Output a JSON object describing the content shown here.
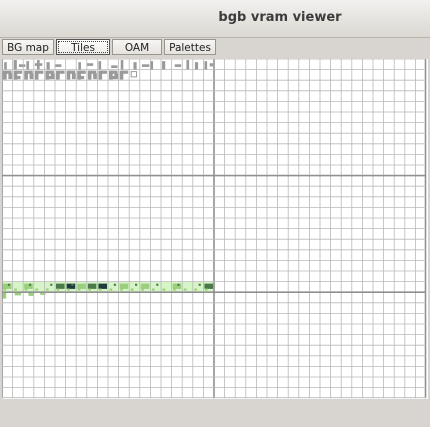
{
  "window": {
    "title": "bgb vram viewer"
  },
  "tabs": [
    {
      "label": "BG map",
      "active": false
    },
    {
      "label": "Tiles",
      "active": true
    },
    {
      "label": "OAM",
      "active": false
    },
    {
      "label": "Palettes",
      "active": false
    }
  ],
  "tile_viewer": {
    "columns": 40,
    "rows": 32,
    "blocks": 3,
    "grid_color": "#b9b9b9",
    "block_divider_color": "#909090",
    "font_glyph_color": "#9a9a9a",
    "sprite_colors": {
      "lightest": "#d6f5c6",
      "light": "#9acf7c",
      "dark": "#4a7a4a",
      "darkest": "#1e3c3c"
    }
  }
}
